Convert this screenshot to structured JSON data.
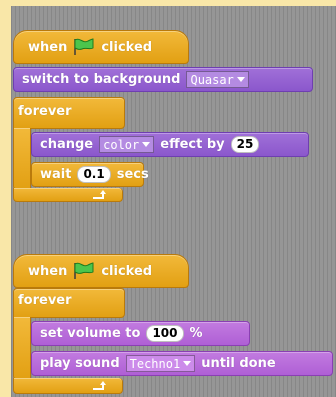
{
  "script1": {
    "hat_when": "when",
    "hat_clicked": "clicked",
    "flag_icon": "green-flag-icon",
    "switch_label": "switch to background",
    "background_value": "Quasar",
    "forever_label": "forever",
    "change_label": "change",
    "effect_value": "color",
    "effect_by_label": "effect by",
    "effect_amount": "25",
    "wait_label": "wait",
    "wait_value": "0.1",
    "wait_secs_label": "secs"
  },
  "script2": {
    "hat_when": "when",
    "hat_clicked": "clicked",
    "flag_icon": "green-flag-icon",
    "forever_label": "forever",
    "set_volume_label": "set volume to",
    "volume_value": "100",
    "volume_unit": "%",
    "play_sound_label": "play sound",
    "sound_value": "Techno1",
    "until_done_label": "until done"
  },
  "colors": {
    "control": "#E6A822",
    "looks": "#8A55CF",
    "sound": "#B56BD9",
    "canvas": "#969696",
    "page": "#F9E7A8"
  }
}
